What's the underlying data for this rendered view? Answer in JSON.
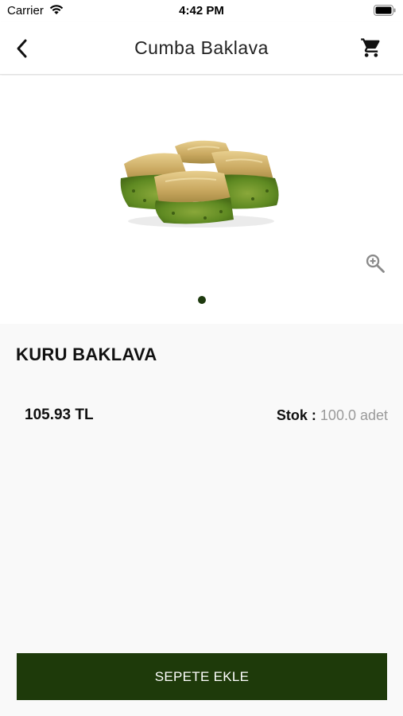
{
  "status_bar": {
    "carrier": "Carrier",
    "time": "4:42 PM"
  },
  "nav": {
    "title": "Cumba Baklava",
    "back_icon": "chevron-left-icon",
    "cart_icon": "shopping-cart-icon"
  },
  "gallery": {
    "image_alt": "baklava",
    "zoom_icon": "zoom-in-icon",
    "page_count": 1,
    "active_page": 1
  },
  "product": {
    "name": "KURU BAKLAVA",
    "price": "105.93 TL",
    "stock_label": "Stok :",
    "stock_value": "100.0 adet"
  },
  "actions": {
    "add_to_cart": "SEPETE EKLE"
  },
  "colors": {
    "accent": "#1e3a0a",
    "detail_background": "#f9f9f9",
    "muted_text": "#9a9a9a"
  }
}
